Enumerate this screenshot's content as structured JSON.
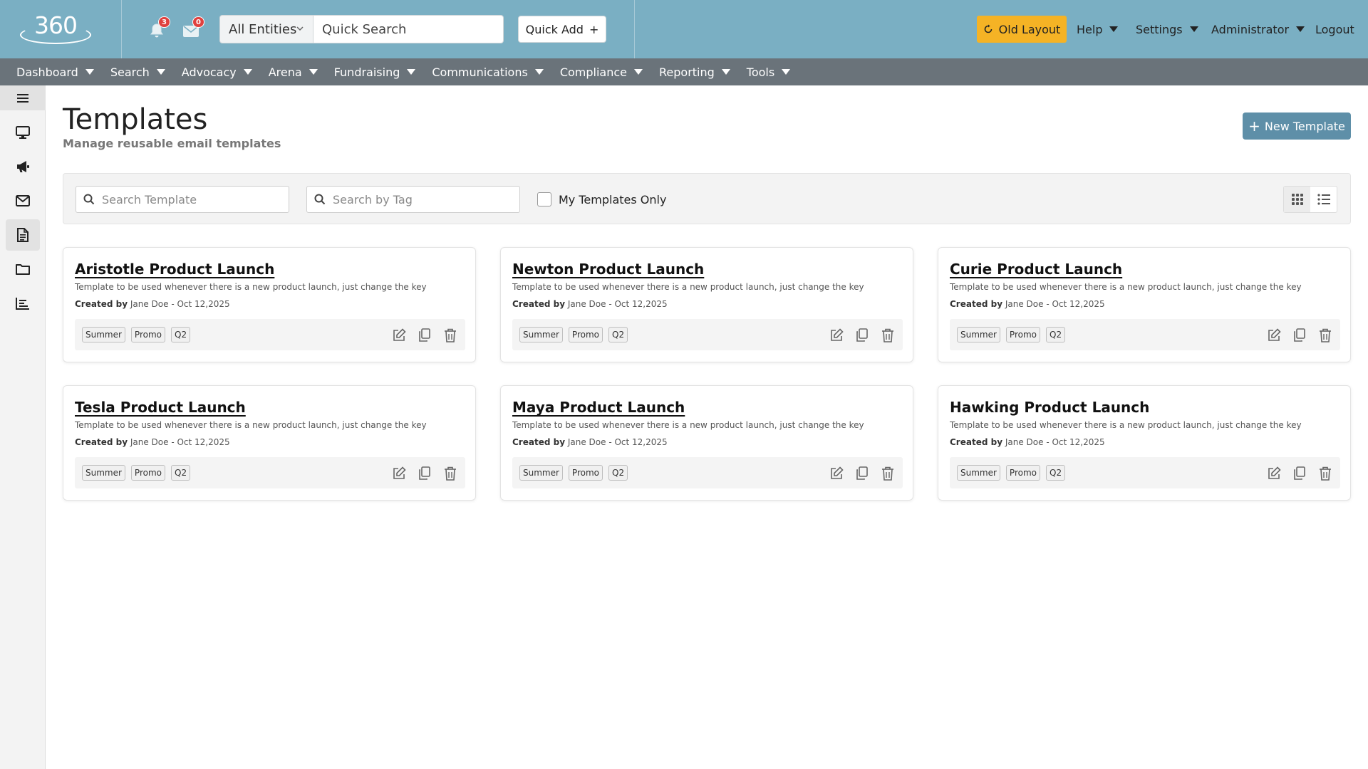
{
  "header": {
    "logo_text": "360",
    "notifications_count": "3",
    "messages_count": "0",
    "entity_select": "All Entities",
    "quick_search_placeholder": "Quick Search",
    "quick_add_label": "Quick Add",
    "old_layout_label": "Old Layout",
    "help_label": "Help",
    "settings_label": "Settings",
    "user_label": "Administrator",
    "logout_label": "Logout"
  },
  "nav": [
    "Dashboard",
    "Search",
    "Advocacy",
    "Arena",
    "Fundraising",
    "Communications",
    "Compliance",
    "Reporting",
    "Tools"
  ],
  "sidebar": {
    "items": [
      "menu-icon",
      "monitor-icon",
      "megaphone-icon",
      "envelope-icon",
      "document-icon",
      "folder-icon",
      "report-icon"
    ],
    "active_index": 4
  },
  "page": {
    "title": "Templates",
    "subtitle": "Manage reusable email templates",
    "new_button": "New Template"
  },
  "filters": {
    "search_template_placeholder": "Search Template",
    "search_tag_placeholder": "Search by Tag",
    "my_templates_label": "My Templates Only",
    "my_templates_checked": false
  },
  "templates": [
    {
      "title": "Aristotle Product Launch",
      "description": "Template to be used whenever there is a new product launch, just change the key",
      "created_by_label": "Created by",
      "created_by": "Jane Doe - Oct 12,2025",
      "tags": [
        "Summer",
        "Promo",
        "Q2"
      ]
    },
    {
      "title": "Newton Product Launch",
      "description": "Template to be used whenever there is a new product launch, just change the key",
      "created_by_label": "Created by",
      "created_by": "Jane Doe - Oct 12,2025",
      "tags": [
        "Summer",
        "Promo",
        "Q2"
      ]
    },
    {
      "title": "Curie Product Launch",
      "description": "Template to be used whenever there is a new product launch, just change the key",
      "created_by_label": "Created by",
      "created_by": "Jane Doe - Oct 12,2025",
      "tags": [
        "Summer",
        "Promo",
        "Q2"
      ]
    },
    {
      "title": "Tesla Product Launch",
      "description": "Template to be used whenever there is a new product launch, just change the key",
      "created_by_label": "Created by",
      "created_by": "Jane Doe - Oct 12,2025",
      "tags": [
        "Summer",
        "Promo",
        "Q2"
      ]
    },
    {
      "title": "Maya Product Launch",
      "description": "Template to be used whenever there is a new product launch, just change the key",
      "created_by_label": "Created by",
      "created_by": "Jane Doe - Oct 12,2025",
      "tags": [
        "Summer",
        "Promo",
        "Q2"
      ]
    },
    {
      "title": "Hawking Product Launch",
      "description": "Template to be used whenever there is a new product launch, just change the key",
      "created_by_label": "Created by",
      "created_by": "Jane Doe - Oct 12,2025",
      "tags": [
        "Summer",
        "Promo",
        "Q2"
      ]
    }
  ],
  "colors": {
    "header_bg": "#7aafc3",
    "nav_bg": "#6a737a",
    "accent": "#5e8fa8",
    "old_layout_bg": "#f5b325",
    "badge": "#e0413f"
  }
}
